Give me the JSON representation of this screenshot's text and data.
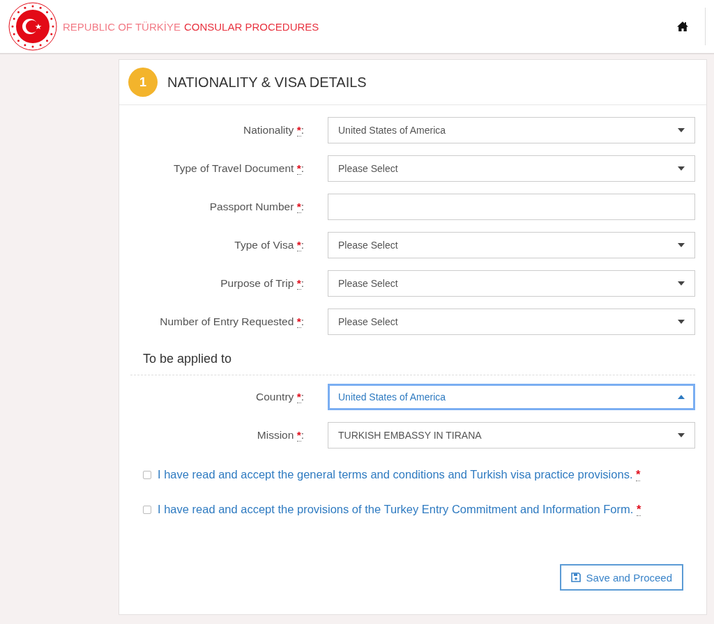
{
  "header": {
    "title_light": "REPUBLIC OF TÜRKİYE",
    "title_bold": "CONSULAR PROCEDURES"
  },
  "step": {
    "number": "1",
    "title": "NATIONALITY & VISA DETAILS"
  },
  "fields": [
    {
      "label": "Nationality",
      "required_mark": "*",
      "separator": ":",
      "kind": "select",
      "value": "United States of America",
      "focused": false
    },
    {
      "label": "Type of Travel Document",
      "required_mark": "*",
      "separator": ":",
      "kind": "select",
      "value": "Please Select",
      "focused": false
    },
    {
      "label": "Passport Number",
      "required_mark": "*",
      "separator": ":",
      "kind": "text",
      "focused": false
    },
    {
      "label": "Type of Visa",
      "required_mark": "*",
      "separator": ":",
      "kind": "select",
      "value": "Please Select",
      "focused": false
    },
    {
      "label": "Purpose of Trip",
      "required_mark": "*",
      "separator": ":",
      "kind": "select",
      "value": "Please Select",
      "focused": false
    },
    {
      "label": "Number of Entry Requested",
      "required_mark": "*",
      "separator": ":",
      "kind": "select",
      "value": "Please Select",
      "focused": false
    }
  ],
  "applied_to": {
    "heading": "To be applied to",
    "fields": [
      {
        "label": "Country",
        "required_mark": "*",
        "separator": ":",
        "kind": "select",
        "value": "United States of America",
        "focused": true
      },
      {
        "label": "Mission",
        "required_mark": "*",
        "separator": ":",
        "kind": "select",
        "value": "TURKISH EMBASSY IN TIRANA",
        "focused": false
      }
    ]
  },
  "agreements": [
    {
      "text": "I have read and accept the general terms and conditions and Turkish visa practice provisions.",
      "required_mark": "*",
      "checked": false
    },
    {
      "text": "I have read and accept the provisions of the Turkey Entry Commitment and Information Form.",
      "required_mark": "*",
      "checked": false
    }
  ],
  "save_button": {
    "label": "Save and Proceed"
  }
}
